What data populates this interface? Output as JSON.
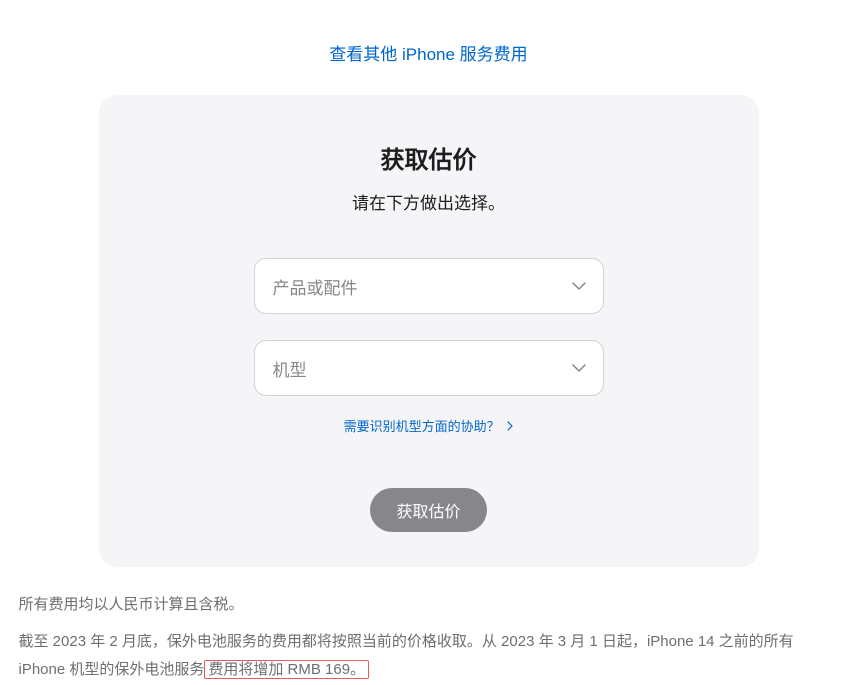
{
  "topLink": {
    "label": "查看其他 iPhone 服务费用"
  },
  "card": {
    "title": "获取估价",
    "subtitle": "请在下方做出选择。",
    "select1": {
      "placeholder": "产品或配件"
    },
    "select2": {
      "placeholder": "机型"
    },
    "helpLink": "需要识别机型方面的协助？",
    "submit": "获取估价"
  },
  "footnote": {
    "line1": "所有费用均以人民币计算且含税。",
    "line2a": "截至 2023 年 2 月底，保外电池服务的费用都将按照当前的价格收取。从 2023 年 3 月 1 日起，iPhone 14 之前的所有 iPhone 机型的保外电池服务",
    "line2b": "费用将增加 RMB 169。"
  }
}
